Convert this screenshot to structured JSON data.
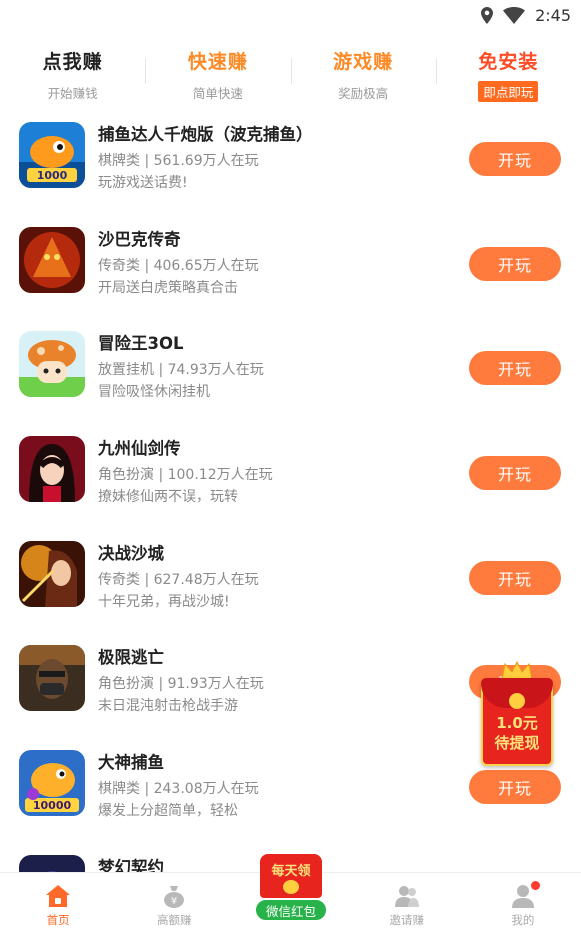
{
  "status_bar": {
    "time": "2:45",
    "icons": [
      "location-icon",
      "wifi-icon"
    ]
  },
  "tabs": [
    {
      "title": "点我赚",
      "subtitle": "开始赚钱",
      "color": "#222222"
    },
    {
      "title": "快速赚",
      "subtitle": "简单快速",
      "color": "#ff8a25"
    },
    {
      "title": "游戏赚",
      "subtitle": "奖励极高",
      "color": "#ff8a25"
    },
    {
      "title": "免安装",
      "badge": "即点即玩",
      "color": "#ff4c25"
    }
  ],
  "games": [
    {
      "name": "捕鱼达人千炮版（波克捕鱼）",
      "meta": "棋牌类 | 561.69万人在玩",
      "desc": "玩游戏送话费!",
      "button": "开玩",
      "icon": "fish-game-icon"
    },
    {
      "name": "沙巴克传奇",
      "meta": "传奇类 | 406.65万人在玩",
      "desc": "开局送白虎策略真合击",
      "button": "开玩",
      "icon": "dragon-game-icon"
    },
    {
      "name": "冒险王3OL",
      "meta": "放置挂机 | 74.93万人在玩",
      "desc": "冒险吸怪休闲挂机",
      "button": "开玩",
      "icon": "mushroom-game-icon"
    },
    {
      "name": "九州仙剑传",
      "meta": "角色扮演 | 100.12万人在玩",
      "desc": "撩妹修仙两不误，玩转",
      "button": "开玩",
      "icon": "fairy-game-icon"
    },
    {
      "name": "决战沙城",
      "meta": "传奇类 | 627.48万人在玩",
      "desc": "十年兄弟，再战沙城!",
      "button": "开玩",
      "icon": "warrior-game-icon"
    },
    {
      "name": "极限逃亡",
      "meta": "角色扮演 | 91.93万人在玩",
      "desc": "末日混沌射击枪战手游",
      "button": "开玩",
      "icon": "soldier-game-icon"
    },
    {
      "name": "大神捕鱼",
      "meta": "棋牌类 | 243.08万人在玩",
      "desc": "爆发上分超简单，轻松",
      "button": "开玩",
      "icon": "fish-game-icon"
    },
    {
      "name": "梦幻契约",
      "meta": "",
      "desc": "",
      "button": "",
      "icon": "fantasy-game-icon"
    }
  ],
  "float_packet": {
    "amount": "1.0元",
    "label": "待提现"
  },
  "wechat_packet": {
    "title": "每天领",
    "button": "微信红包"
  },
  "bottom_nav": [
    {
      "label": "首页",
      "icon": "home-icon",
      "active": true
    },
    {
      "label": "高额赚",
      "icon": "money-bag-icon",
      "active": false
    },
    {
      "label": "",
      "icon": "red-packet-icon",
      "active": false
    },
    {
      "label": "邀请赚",
      "icon": "users-icon",
      "active": false
    },
    {
      "label": "我的",
      "icon": "person-icon",
      "active": false
    }
  ],
  "colors": {
    "accent": "#ff7a3d",
    "tab_orange": "#ff8a25",
    "tab_red": "#ff4c25",
    "wechat_green": "#28b34a"
  }
}
